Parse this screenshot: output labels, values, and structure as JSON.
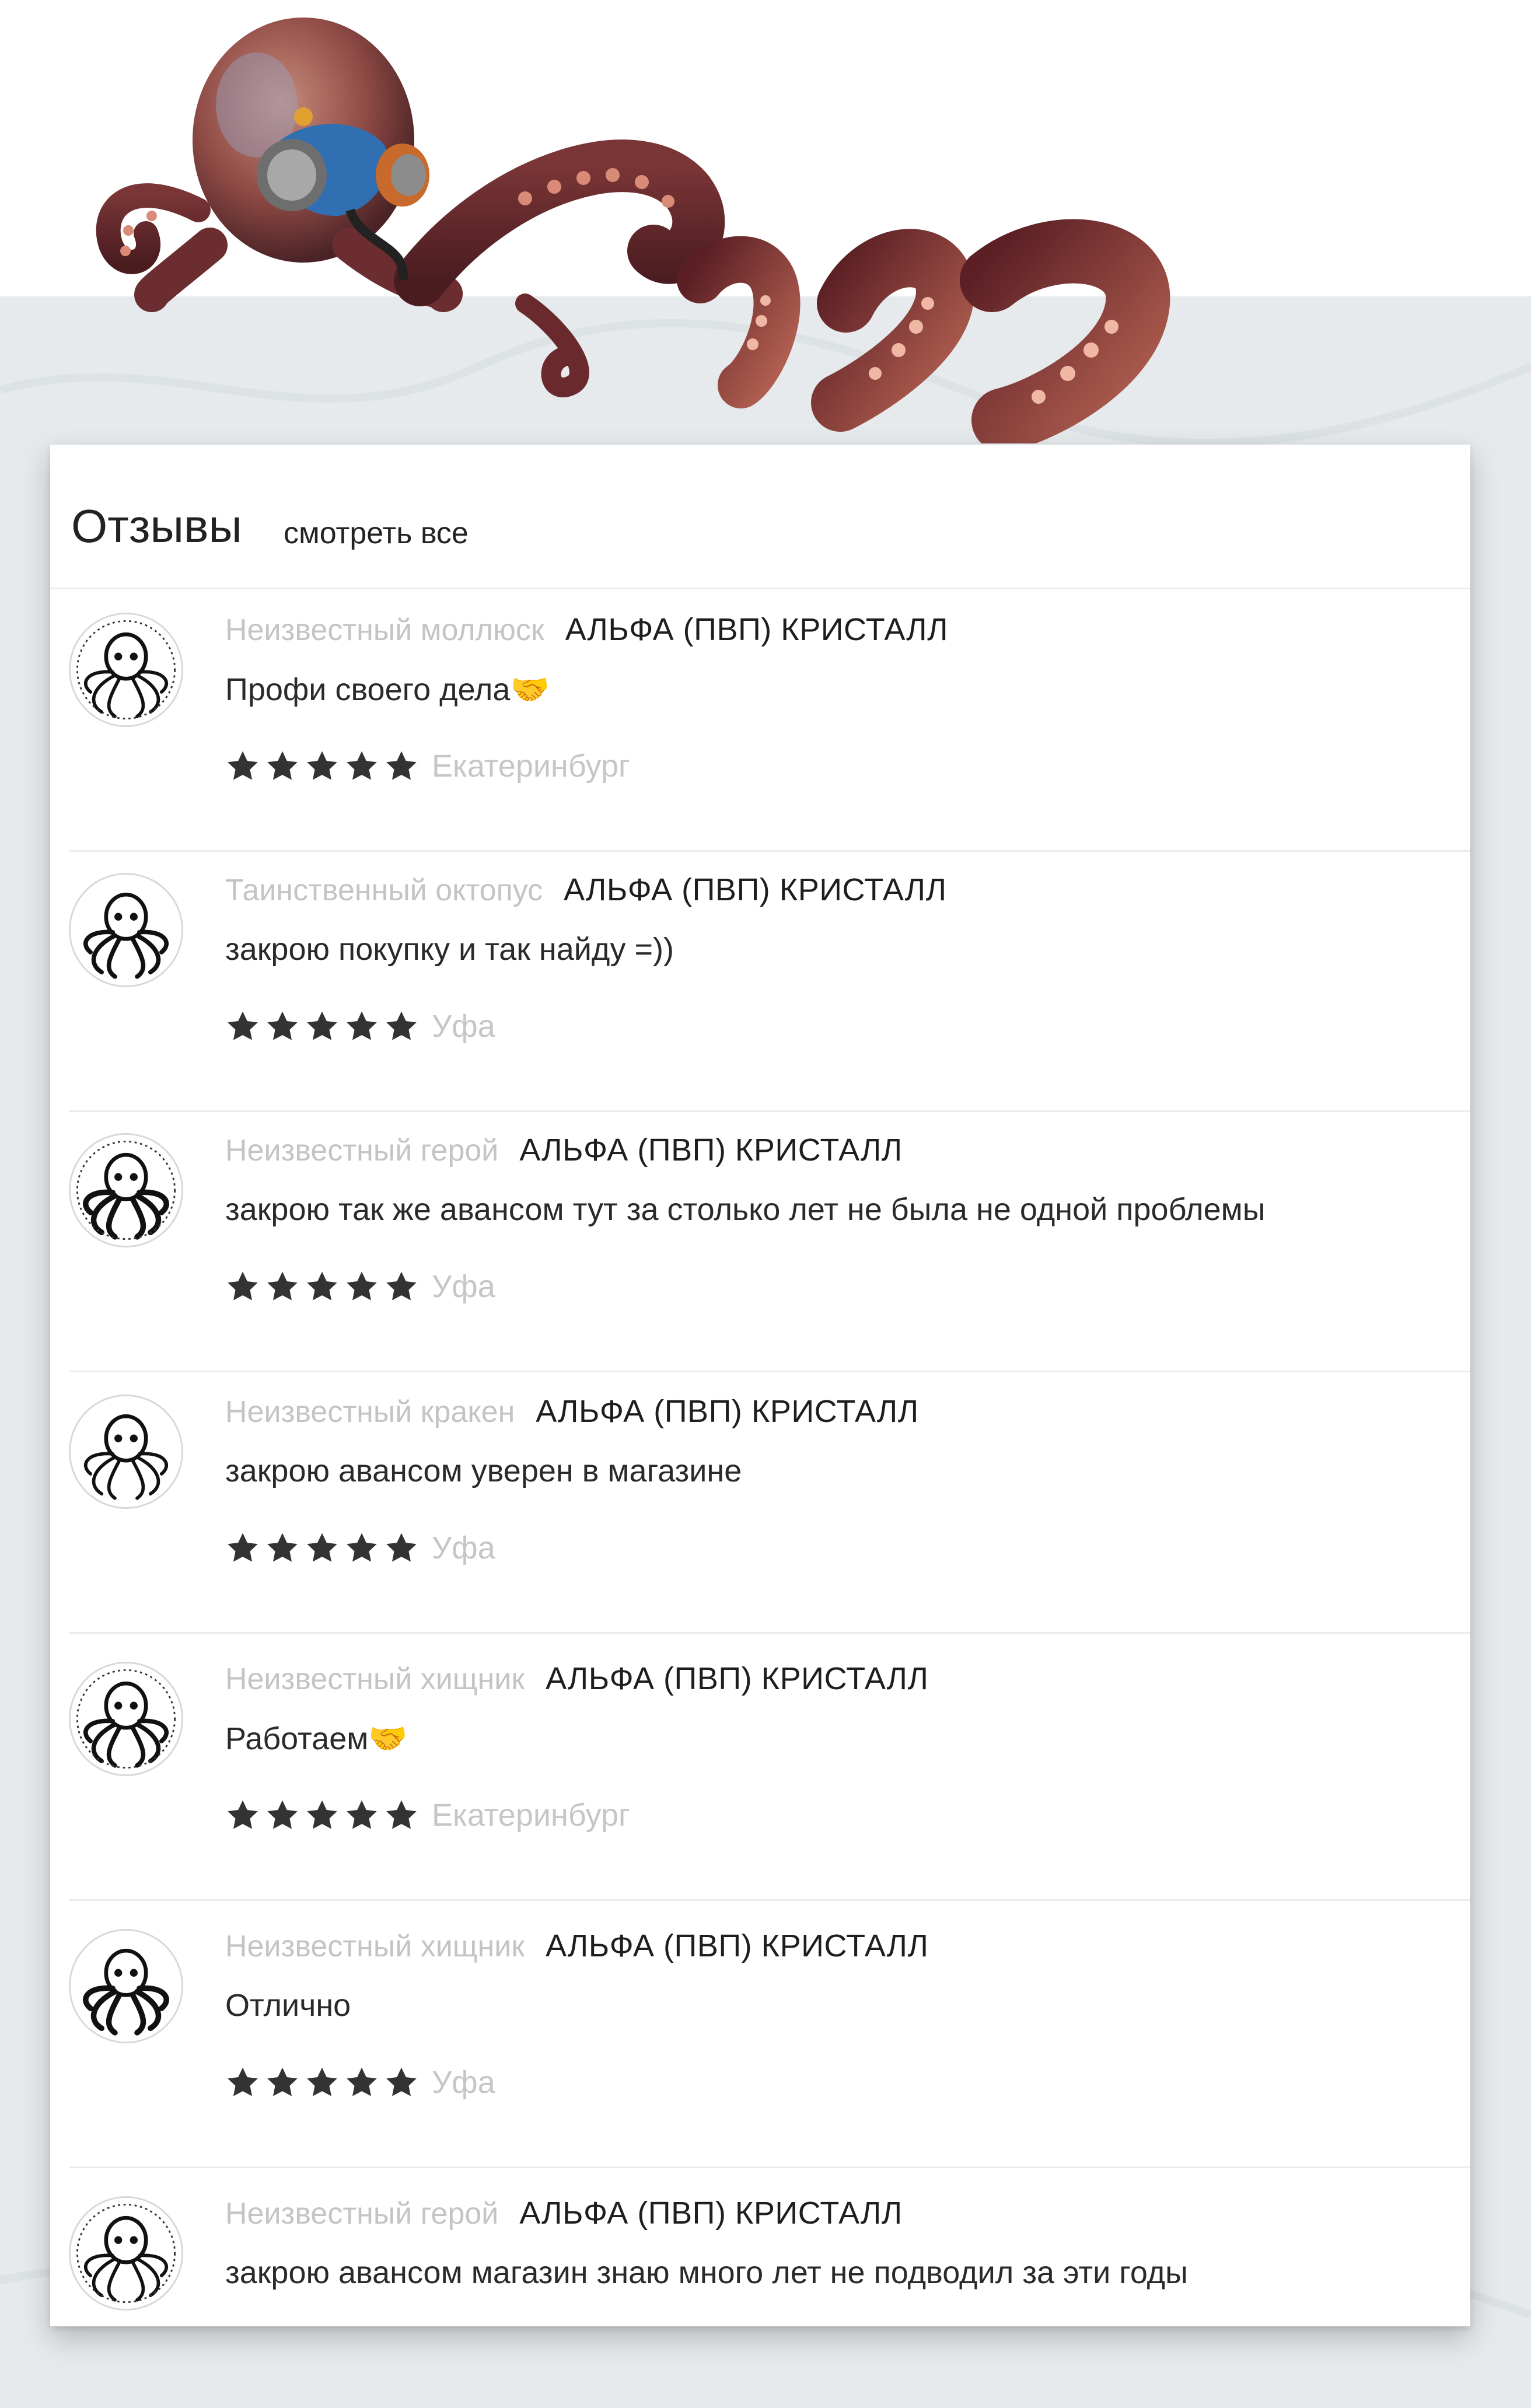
{
  "header": {
    "title": "Отзывы",
    "see_all": "смотреть все"
  },
  "stars_per_review": 5,
  "colors": {
    "star": "#333333",
    "author": "#c4c4c4",
    "city": "#c6c6c6",
    "emoji": "#f2b32e"
  },
  "reviews": [
    {
      "author": "Неизвестный моллюск",
      "product": "АЛЬФА (ПВП) КРИСТАЛЛ",
      "text": "Профи своего дела",
      "emoji": "🤝",
      "rating": 5,
      "city": "Екатеринбург"
    },
    {
      "author": "Таинственный октопус",
      "product": "АЛЬФА (ПВП) КРИСТАЛЛ",
      "text": "закрою покупку и так найду =))",
      "emoji": "",
      "rating": 5,
      "city": "Уфа"
    },
    {
      "author": "Неизвестный герой",
      "product": "АЛЬФА (ПВП) КРИСТАЛЛ",
      "text": "закрою так же авансом тут за столько лет не была не одной проблемы",
      "emoji": "",
      "rating": 5,
      "city": "Уфа"
    },
    {
      "author": "Неизвестный кракен",
      "product": "АЛЬФА (ПВП) КРИСТАЛЛ",
      "text": "закрою авансом уверен в магазине",
      "emoji": "",
      "rating": 5,
      "city": "Уфа"
    },
    {
      "author": "Неизвестный хищник",
      "product": "АЛЬФА (ПВП) КРИСТАЛЛ",
      "text": "Работаем",
      "emoji": "🤝",
      "rating": 5,
      "city": "Екатеринбург"
    },
    {
      "author": "Неизвестный хищник",
      "product": "АЛЬФА (ПВП) КРИСТАЛЛ",
      "text": "Отлично",
      "emoji": "",
      "rating": 5,
      "city": "Уфа"
    },
    {
      "author": "Неизвестный герой",
      "product": "АЛЬФА (ПВП) КРИСТАЛЛ",
      "text": "закрою авансом магазин знаю много лет не подводил за эти годы",
      "emoji": "",
      "rating": null,
      "city": ""
    }
  ]
}
